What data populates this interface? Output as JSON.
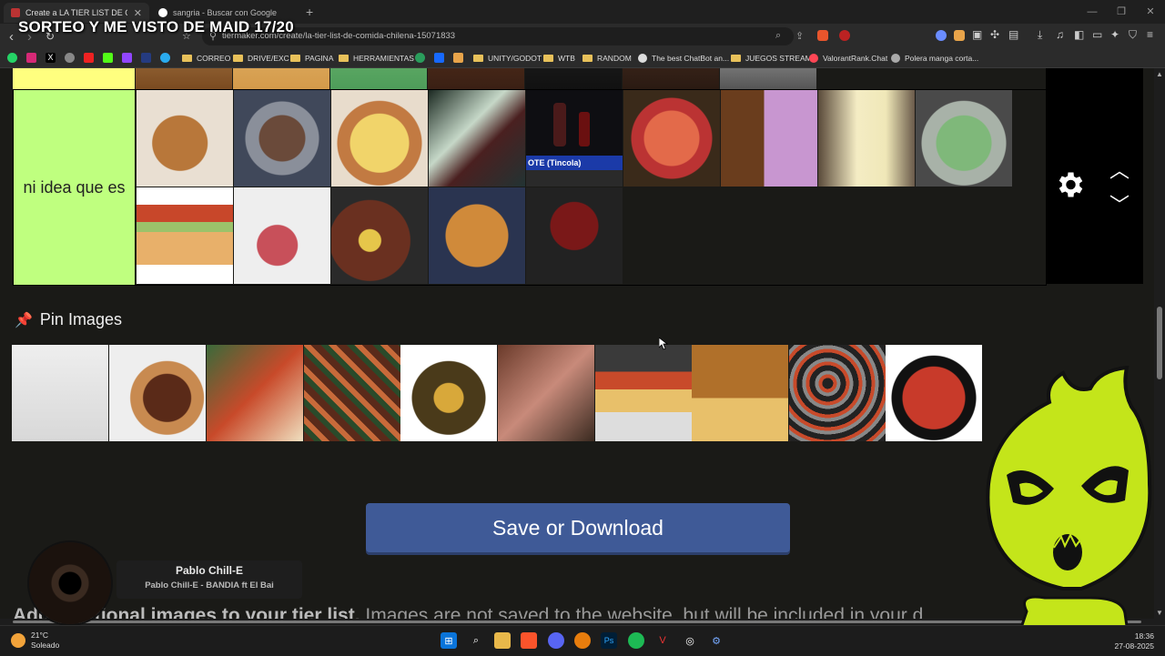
{
  "browser": {
    "tabs": [
      {
        "title": "Create a LA TIER LIST DE COMI",
        "active": true
      },
      {
        "title": "sangria - Buscar con Google",
        "active": false
      }
    ],
    "url": "tiermaker.com/create/la-tier-list-de-comida-chilena-15071833"
  },
  "stream_overlay": {
    "title": "SORTEO Y ME VISTO DE MAID 17/20"
  },
  "bookmarks": [
    {
      "label": "CORREO",
      "type": "folder"
    },
    {
      "label": "DRIVE/EXC",
      "type": "folder"
    },
    {
      "label": "PAGINA",
      "type": "folder"
    },
    {
      "label": "HERRAMIENTAS",
      "type": "folder"
    },
    {
      "label": "UNITY/GODOT",
      "type": "folder"
    },
    {
      "label": "WTB",
      "type": "folder"
    },
    {
      "label": "RANDOM",
      "type": "folder"
    },
    {
      "label": "The best ChatBot an...",
      "type": "link"
    },
    {
      "label": "JUEGOS STREAM",
      "type": "folder"
    },
    {
      "label": "ValorantRank.Chat",
      "type": "link"
    },
    {
      "label": "Polera manga corta...",
      "type": "link"
    }
  ],
  "tier": {
    "label": "ni idea que es",
    "label_color": "#bfff7f"
  },
  "pin_images": {
    "heading": "Pin Images"
  },
  "save_button": {
    "label": "Save or Download"
  },
  "footer": {
    "bold": "Add additional images to your tier list.",
    "text": " Images are not saved to the website, but will be included in your d"
  },
  "now_playing": {
    "artist": "Pablo Chill-E",
    "song": "Pablo Chill-E - BANDIA ft El Bai"
  },
  "taskbar": {
    "temperature": "21°C",
    "condition": "Soleado",
    "time": "18:36",
    "date": "27-08-2025"
  },
  "colors": {
    "tier_top_yellow": "#ffff7f",
    "tier_green": "#bfff7f",
    "save_button": "#3f5a97",
    "mascot_green": "#c4e51a"
  }
}
